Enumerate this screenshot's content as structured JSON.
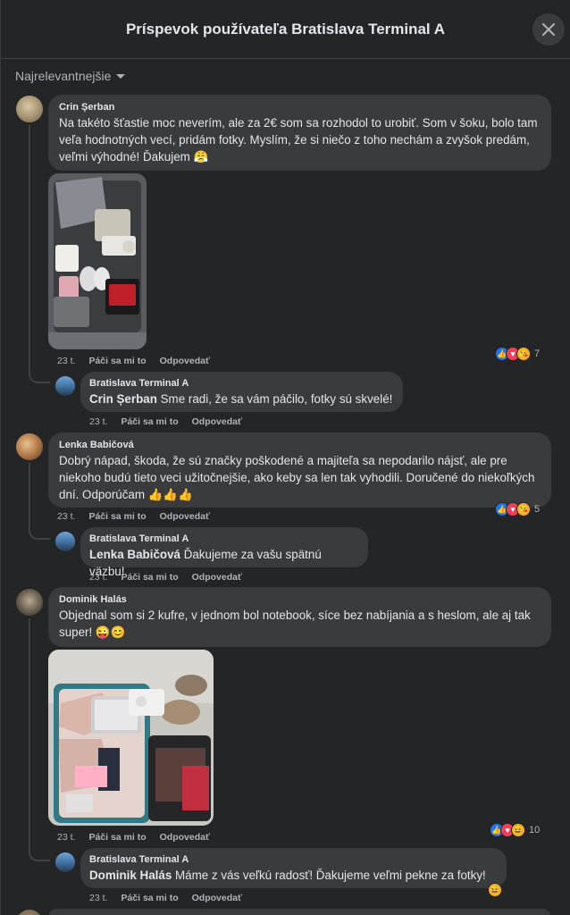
{
  "header": {
    "title": "Príspevok používateľa Bratislava Terminal A"
  },
  "sort": {
    "label": "Najrelevantnejšie"
  },
  "comments": [
    {
      "author": "Crin Șerban",
      "text": "Na takéto šťastie moc neverím, ale za 2€ som sa rozhodol to urobiť. Som v šoku, bolo tam veľa hodnotných vecí, pridám fotky. Myslím, že si niečo z toho nechám a zvyšok predám, veľmi výhodné! Ďakujem 😤",
      "time": "23 t.",
      "like": "Páči sa mi to",
      "reply": "Odpovedať",
      "reaction_count": "7",
      "reply_item": {
        "author": "Bratislava Terminal A",
        "mention": "Crin Șerban",
        "text": " Sme radi, že sa vám páčilo, fotky sú skvelé!",
        "time": "23 t.",
        "like": "Páči sa mi to",
        "reply": "Odpovedať"
      }
    },
    {
      "author": "Lenka Babičová",
      "text": "Dobrý nápad, škoda, že sú značky poškodené a majiteľa sa nepodarilo nájsť, ale pre niekoho budú tieto veci užitočnejšie, ako keby sa len tak vyhodili. Doručené do niekoľkých dní. Odporúčam 👍👍👍",
      "time": "23 t.",
      "like": "Páči sa mi to",
      "reply": "Odpovedať",
      "reaction_count": "5",
      "reply_item": {
        "author": "Bratislava Terminal A",
        "mention": "Lenka Babičová",
        "text": " Ďakujeme za vašu spätnú väzbu!",
        "time": "23 t.",
        "like": "Páči sa mi to",
        "reply": "Odpovedať"
      }
    },
    {
      "author": "Dominik Halás",
      "text": "Objednal som si 2 kufre, v jednom bol notebook, síce bez nabíjania a s heslom, ale aj tak super! 😜😊",
      "time": "23 t.",
      "like": "Páči sa mi to",
      "reply": "Odpovedať",
      "reaction_count": "10",
      "reply_item": {
        "author": "Bratislava Terminal A",
        "mention": "Dominik Halás",
        "text": " Máme z vás veľkú radosť! Ďakujeme veľmi pekne za fotky!",
        "time": "23 t.",
        "like": "Páči sa mi to",
        "reply": "Odpovedať"
      }
    }
  ],
  "colors": {
    "background": "#242526",
    "bubble": "#3a3b3c",
    "text": "#e4e6eb",
    "secondary": "#b0b3b8",
    "like": "#1877f2",
    "love": "#f33e58"
  }
}
